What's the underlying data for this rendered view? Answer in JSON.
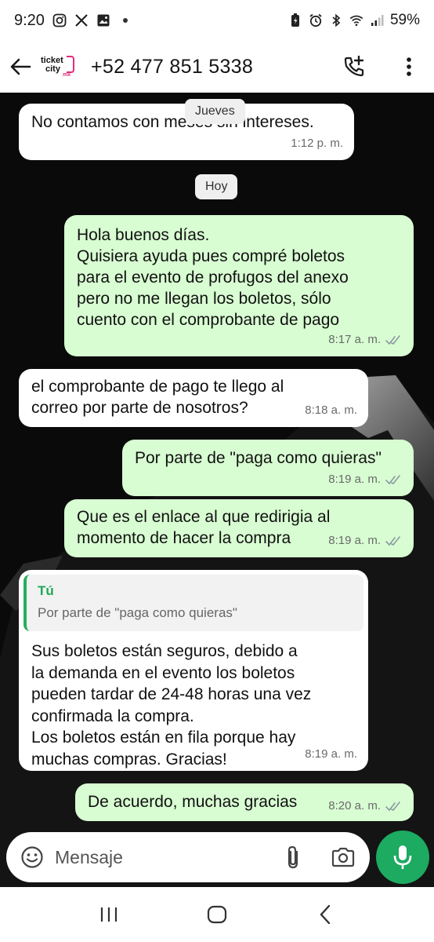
{
  "status_bar": {
    "time": "9:20",
    "battery": "59%",
    "left_icons": [
      "instagram-icon",
      "x-icon",
      "gallery-icon",
      "dot-icon"
    ],
    "right_icons": [
      "battery-saver-icon",
      "alarm-icon",
      "bluetooth-icon",
      "wifi-icon",
      "signal-icon"
    ]
  },
  "header": {
    "logo": {
      "line1": "ticket",
      "line2": "city",
      "suffix": "mx"
    },
    "contact": "+52 477 851 5338",
    "actions": [
      "back-arrow-icon",
      "add-call-icon",
      "more-vert-icon"
    ]
  },
  "chat": {
    "date_chips": {
      "day1": "Jueves",
      "day2": "Hoy"
    },
    "messages": [
      {
        "dir": "in",
        "text": "No contamos con meses sin intereses.",
        "time": "1:12 p. m."
      },
      {
        "dir": "out",
        "text": "Hola buenos días.\nQuisiera ayuda pues compré boletos\npara el evento de profugos del anexo\npero no me llegan los boletos, sólo\ncuento con el comprobante de pago",
        "time": "8:17 a. m.",
        "status": "read"
      },
      {
        "dir": "in",
        "text": "el comprobante de pago te llego al\ncorreo por parte de nosotros?",
        "time": "8:18 a. m."
      },
      {
        "dir": "out",
        "text": "Por parte de \"paga como quieras\"",
        "time": "8:19 a. m.",
        "status": "read"
      },
      {
        "dir": "out",
        "text": "Que es el enlace al que redirigia al\nmomento de hacer la compra",
        "time": "8:19 a. m.",
        "status": "read"
      },
      {
        "dir": "in",
        "quote_author": "Tú",
        "quote_text": "Por parte de \"paga como quieras\"",
        "text": "Sus boletos están seguros, debido a\nla demanda en el evento los boletos\npueden tardar de 24-48 horas una vez\nconfirmada la compra.\nLos boletos están en fila porque hay\nmuchas compras. Gracias!",
        "time": "8:19 a. m."
      },
      {
        "dir": "out",
        "text": "De acuerdo, muchas gracias",
        "time": "8:20 a. m.",
        "status": "read"
      }
    ]
  },
  "composer": {
    "placeholder": "Mensaje"
  },
  "colors": {
    "outgoing_bubble": "#d8fdd2",
    "incoming_bubble": "#ffffff",
    "accent_green": "#1daa61",
    "read_ticks": "#8a9aa0",
    "quote_author": "#1fa855"
  }
}
